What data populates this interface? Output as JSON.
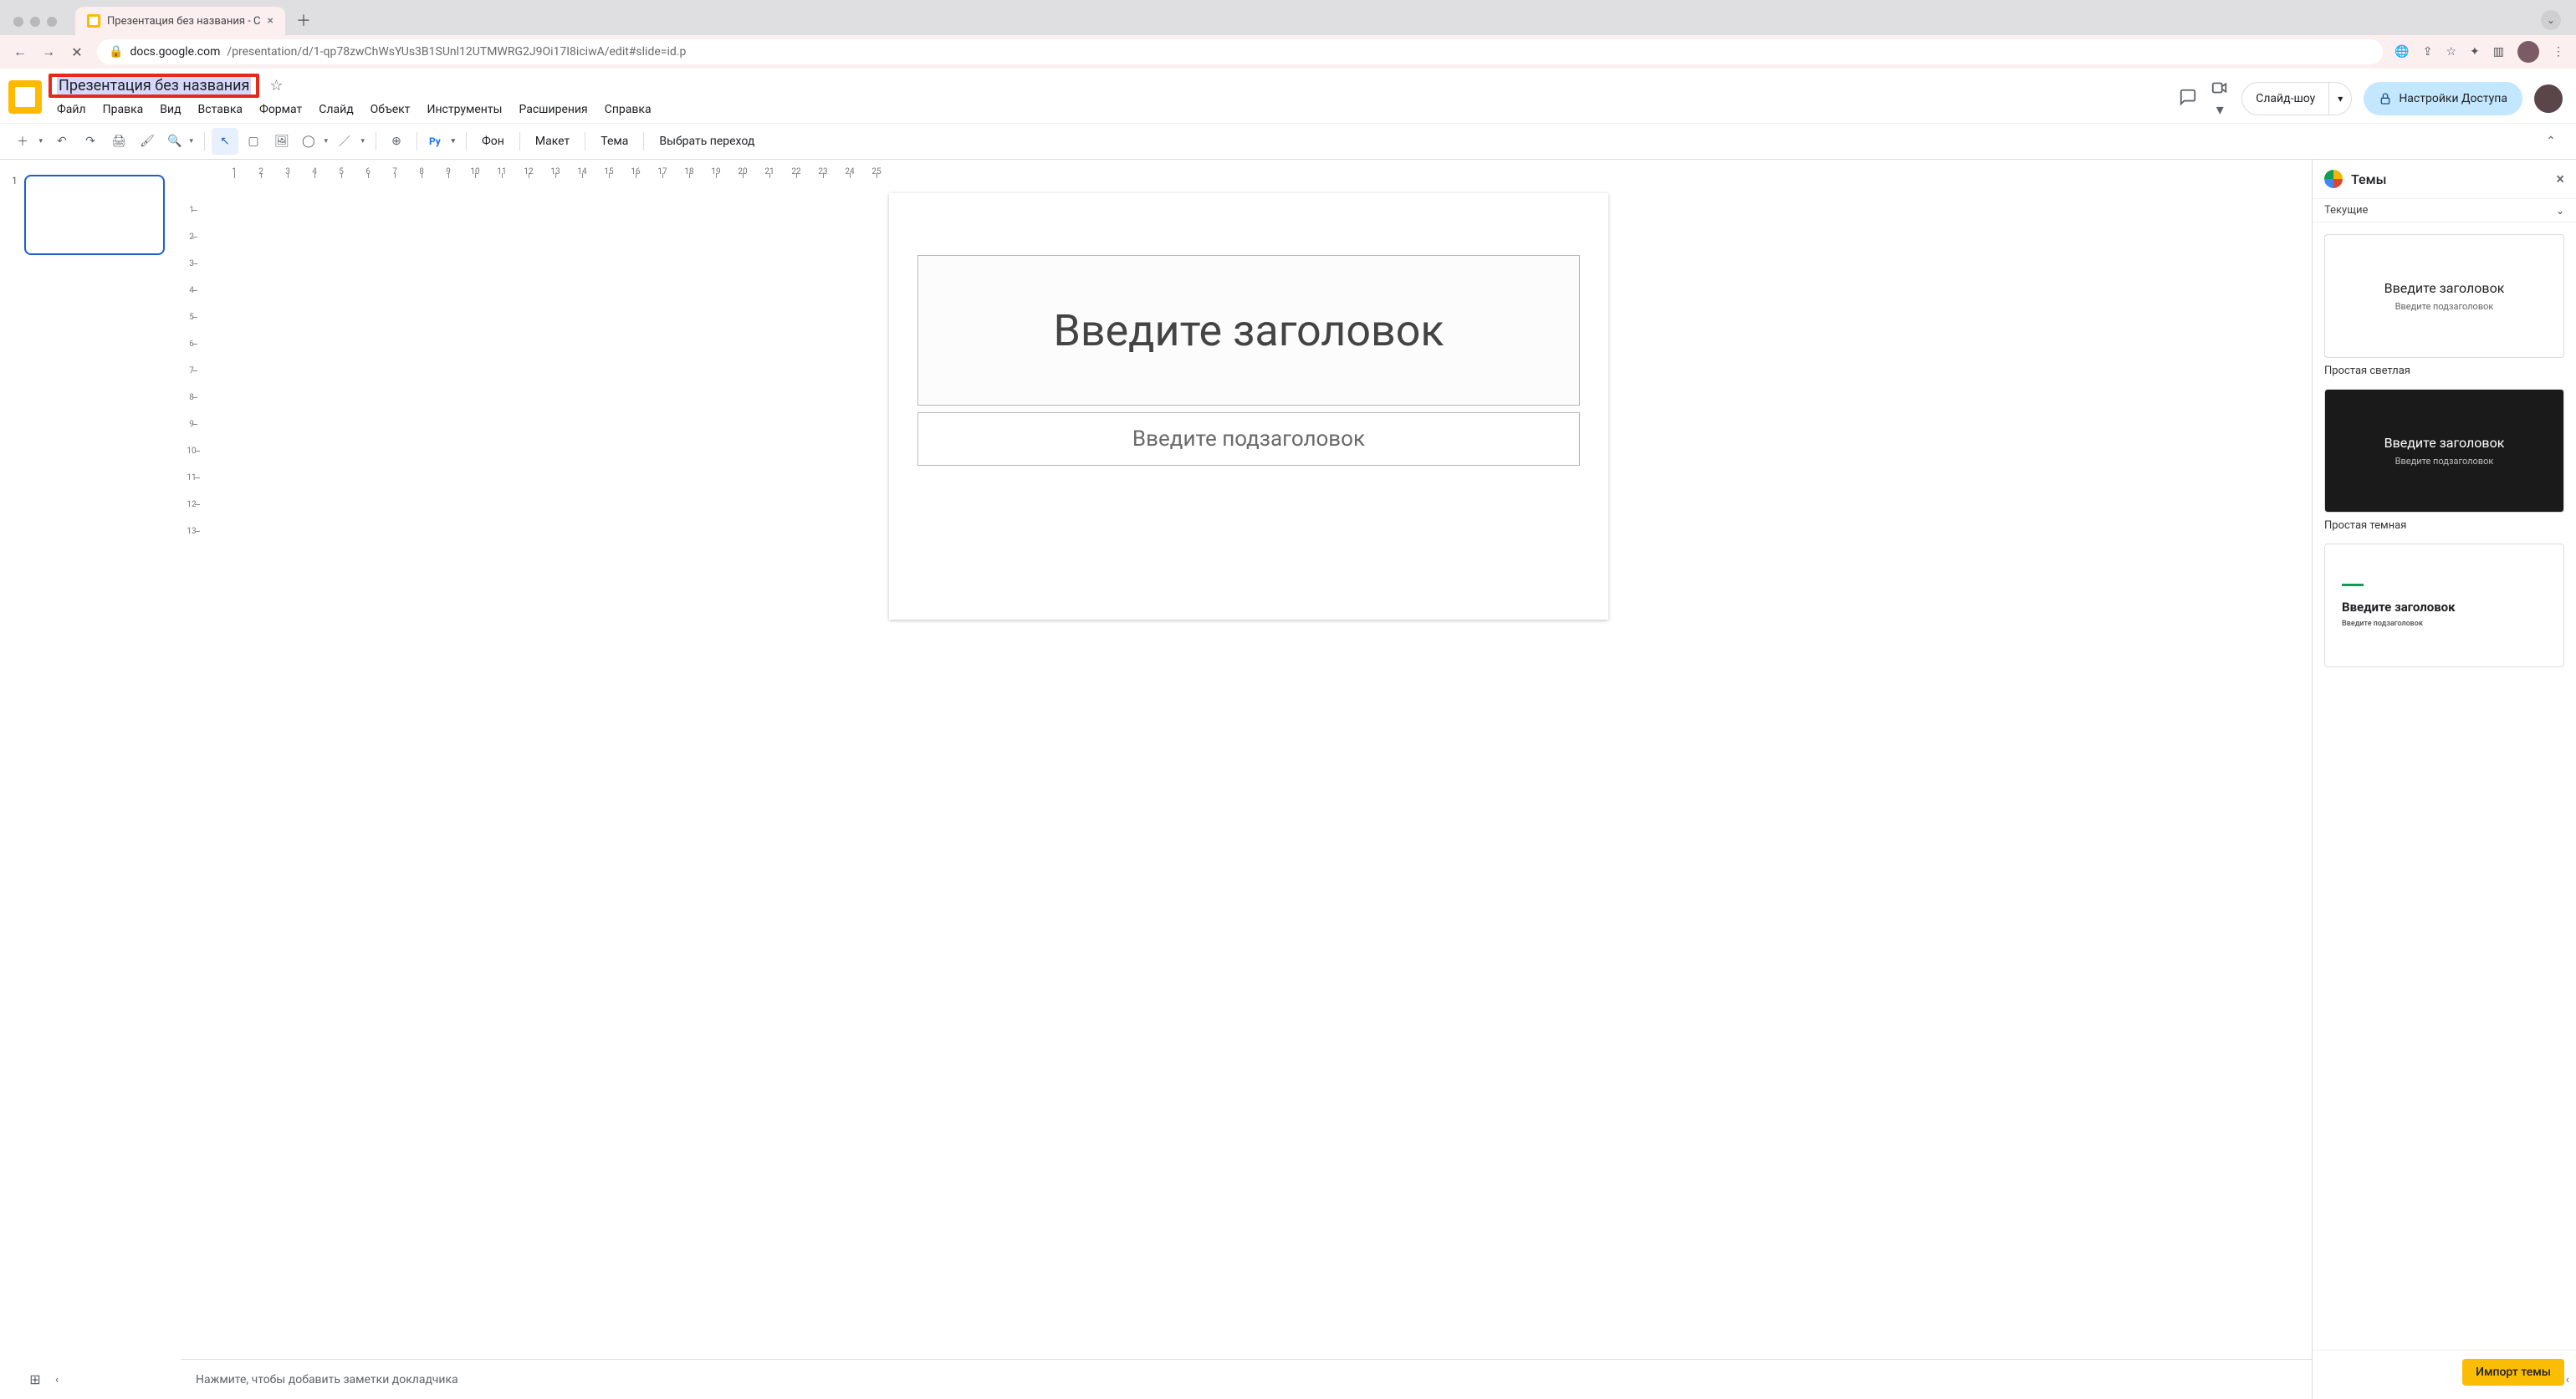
{
  "browser": {
    "tab_title": "Презентация без названия - С",
    "url_host": "docs.google.com",
    "url_path": "/presentation/d/1-qp78zwChWsYUs3B1SUnl12UTMWRG2J9Oi17I8iciwA/edit#slide=id.p"
  },
  "header": {
    "doc_title": "Презентация без названия",
    "present_label": "Слайд-шоу",
    "share_label": "Настройки Доступа"
  },
  "menus": [
    "Файл",
    "Правка",
    "Вид",
    "Вставка",
    "Формат",
    "Слайд",
    "Объект",
    "Инструменты",
    "Расширения",
    "Справка"
  ],
  "toolbar": {
    "background": "Фон",
    "layout": "Макет",
    "theme": "Тема",
    "transition": "Выбрать переход"
  },
  "ruler_h": [
    "1",
    "2",
    "3",
    "4",
    "5",
    "6",
    "7",
    "8",
    "9",
    "10",
    "11",
    "12",
    "13",
    "14",
    "15",
    "16",
    "17",
    "18",
    "19",
    "20",
    "21",
    "22",
    "23",
    "24",
    "25"
  ],
  "ruler_v": [
    "1",
    "2",
    "3",
    "4",
    "5",
    "6",
    "7",
    "8",
    "9",
    "10",
    "11",
    "12",
    "13"
  ],
  "filmstrip": {
    "first_index": "1"
  },
  "canvas": {
    "title_placeholder": "Введите заголовок",
    "subtitle_placeholder": "Введите подзаголовок"
  },
  "notes_placeholder": "Нажмите, чтобы добавить заметки докладчика",
  "themes": {
    "panel_title": "Темы",
    "section_current": "Текущие",
    "preview_title": "Введите заголовок",
    "preview_subtitle": "Введите подзаголовок",
    "label_light": "Простая светлая",
    "label_dark": "Простая темная",
    "import_label": "Импорт темы"
  },
  "colors": {
    "highlight": "#e8291a",
    "share_bg": "#c2e7ff",
    "accent": "#1a73e8"
  }
}
